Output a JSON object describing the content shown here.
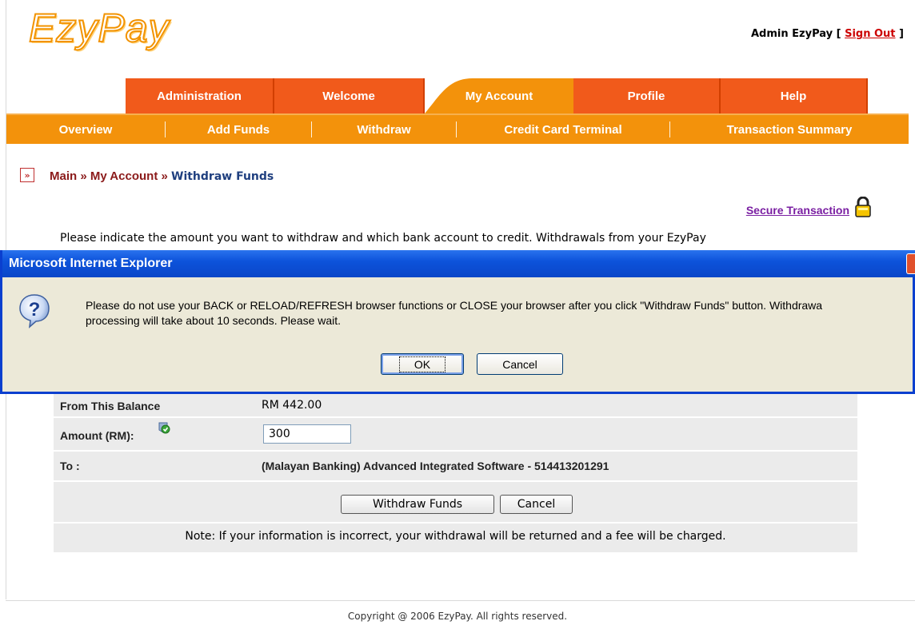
{
  "header": {
    "logo_text": "EzyPay",
    "logo_mark": "®",
    "user_prefix": "Admin EzyPay [ ",
    "sign_out": "Sign Out",
    "user_suffix": " ]"
  },
  "main_nav": [
    "Administration",
    "Welcome",
    "My Account",
    "Profile",
    "Help"
  ],
  "sub_nav": [
    "Overview",
    "Add Funds",
    "Withdraw",
    "Credit Card Terminal",
    "Transaction Summary"
  ],
  "breadcrumb": {
    "icon": "»",
    "main": "Main",
    "sep": " » ",
    "account": "My Account",
    "current": "Withdraw Funds"
  },
  "secure_link": "Secure Transaction",
  "intro_text": "Please indicate the amount you want to withdraw and which bank account to credit. Withdrawals from your EzyPay",
  "form": {
    "balance_label": "From This Balance",
    "balance_value": "RM 442.00",
    "amount_label": "Amount (RM):",
    "amount_value": "300",
    "to_label": "To :",
    "to_value": "(Malayan Banking) Advanced Integrated Software - 514413201291",
    "withdraw_button": "Withdraw Funds",
    "cancel_button": "Cancel",
    "note": "Note: If your information is incorrect, your withdrawal will be returned and a fee will be charged."
  },
  "dialog": {
    "title": "Microsoft Internet Explorer",
    "message": "Please do not use your BACK or RELOAD/REFRESH browser functions or CLOSE your browser after you click \"Withdraw Funds\" button. Withdrawa\nprocessing will take about 10 seconds. Please wait.",
    "ok": "OK",
    "cancel": "Cancel"
  },
  "footer": "Copyright @ 2006 EzyPay. All rights reserved.",
  "colors": {
    "tab_orange": "#f15a1b",
    "subnav_orange": "#f3920b",
    "dialog_blue": "#0a46c8",
    "dialog_bg": "#ece9d8"
  }
}
